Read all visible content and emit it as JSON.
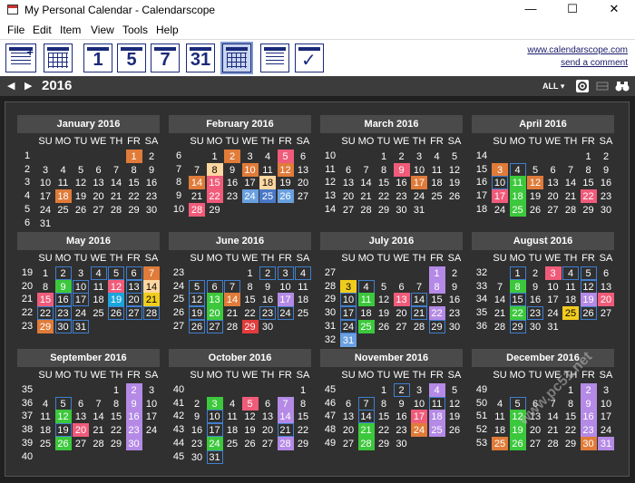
{
  "window": {
    "title": "My Personal Calendar - Calendarscope",
    "minimize": "—",
    "maximize": "☐",
    "close": "✕"
  },
  "menu": [
    "File",
    "Edit",
    "Item",
    "View",
    "Tools",
    "Help"
  ],
  "toolbar": {
    "day_labels": [
      "1",
      "5",
      "7",
      "31"
    ]
  },
  "links": {
    "site": "www.calendarscope.com",
    "feedback": "send a comment"
  },
  "nav": {
    "prev": "◀",
    "next": "▶",
    "year": "2016",
    "filter": "ALL ▾"
  },
  "weekdays": [
    "SU",
    "MO",
    "TU",
    "WE",
    "TH",
    "FR",
    "SA"
  ],
  "colors": {
    "orange": "#e07b39",
    "pink": "#f05b7a",
    "green": "#3cc83c",
    "purple": "#b48ae6",
    "cyan": "#1aa5dc",
    "yellow": "#f0cc1e",
    "peach": "#ffd7a0",
    "blue": "#4a78c8",
    "sky": "#6aa0e0",
    "red": "#e23c3c",
    "outline": "#3f7fcf"
  },
  "months": [
    {
      "name": "January 2016",
      "first": 5,
      "days": 31,
      "weeks": [
        1,
        2,
        3,
        4,
        5,
        6
      ],
      "marks": {
        "1": "or",
        "18": "or"
      }
    },
    {
      "name": "February 2016",
      "first": 1,
      "days": 29,
      "weeks": [
        6,
        7,
        8,
        9,
        10
      ],
      "marks": {
        "2": "or",
        "5": "pk",
        "8": "pe",
        "10": "or",
        "12": "or",
        "14": "or",
        "15": "pk",
        "18": "pe",
        "22": "pk",
        "24": "sl",
        "25": "bl",
        "26": "sl",
        "28": "pk"
      }
    },
    {
      "name": "March 2016",
      "first": 2,
      "days": 31,
      "weeks": [
        10,
        11,
        12,
        13,
        14
      ],
      "marks": {
        "9": "pk",
        "17": "or"
      }
    },
    {
      "name": "April 2016",
      "first": 5,
      "days": 30,
      "weeks": [
        14,
        15,
        16,
        17,
        18
      ],
      "marks": {
        "3": "or",
        "4": "o",
        "10": "o",
        "11": "gr",
        "12": "or",
        "17": "pk",
        "18": "gr",
        "22": "pk",
        "25": "gr"
      }
    },
    {
      "name": "May 2016",
      "first": 0,
      "days": 31,
      "weeks": [
        19,
        20,
        21,
        22,
        23
      ],
      "marks": {
        "2": "o",
        "4": "o",
        "5": "o",
        "6": "o",
        "7": "or",
        "9": "gr",
        "10": "o",
        "12": "pk",
        "13": "o",
        "14": "pe",
        "15": "pk",
        "16": "o",
        "17": "o",
        "19": "cy",
        "20": "o",
        "21": "ye",
        "22": "o",
        "23": "o",
        "26": "o",
        "27": "o",
        "28": "o",
        "29": "or",
        "30": "o",
        "31": "o"
      }
    },
    {
      "name": "June 2016",
      "first": 3,
      "days": 30,
      "weeks": [
        23,
        24,
        25,
        26,
        27
      ],
      "marks": {
        "2": "o",
        "3": "o",
        "4": "o",
        "5": "o",
        "6": "o",
        "7": "o",
        "12": "o",
        "13": "gr",
        "14": "or",
        "17": "pu",
        "19": "o",
        "20": "gr",
        "23": "o",
        "24": "o",
        "26": "o",
        "27": "o",
        "29": "dr"
      }
    },
    {
      "name": "July 2016",
      "first": 5,
      "days": 31,
      "weeks": [
        27,
        28,
        29,
        30,
        31,
        32
      ],
      "marks": {
        "1": "pu",
        "3": "ye",
        "4": "o",
        "8": "pu",
        "10": "o",
        "11": "gr",
        "13": "pk",
        "14": "o",
        "17": "o",
        "21": "o",
        "22": "pu",
        "24": "o",
        "25": "gr",
        "29": "o",
        "31": "sl"
      }
    },
    {
      "name": "August 2016",
      "first": 1,
      "days": 31,
      "weeks": [
        32,
        33,
        34,
        35,
        36
      ],
      "marks": {
        "1": "o",
        "3": "pk",
        "4": "o",
        "5": "o",
        "8": "gr",
        "12": "o",
        "15": "o",
        "19": "pu",
        "20": "pk",
        "22": "gr",
        "23": "o",
        "25": "ye",
        "26": "o",
        "29": "o"
      }
    },
    {
      "name": "September 2016",
      "first": 4,
      "days": 30,
      "weeks": [
        35,
        36,
        37,
        38,
        39,
        40
      ],
      "marks": {
        "2": "pu",
        "5": "o",
        "9": "pu",
        "12": "gr",
        "16": "pu",
        "19": "o",
        "20": "pk",
        "23": "pu",
        "26": "gr",
        "30": "pu"
      }
    },
    {
      "name": "October 2016",
      "first": 6,
      "days": 31,
      "weeks": [
        40,
        41,
        42,
        43,
        44,
        45
      ],
      "marks": {
        "3": "gr",
        "5": "pk",
        "7": "pu",
        "10": "o",
        "14": "pu",
        "17": "o",
        "21": "o",
        "24": "gr",
        "28": "pu",
        "31": "o"
      }
    },
    {
      "name": "November 2016",
      "first": 2,
      "days": 30,
      "weeks": [
        45,
        46,
        47,
        48,
        49
      ],
      "marks": {
        "2": "o",
        "4": "pu",
        "7": "o",
        "11": "o",
        "14": "o",
        "17": "pk",
        "18": "pu",
        "21": "gr",
        "24": "or",
        "25": "pu",
        "28": "gr"
      }
    },
    {
      "name": "December 2016",
      "first": 4,
      "days": 31,
      "weeks": [
        49,
        50,
        51,
        52,
        53
      ],
      "marks": {
        "2": "pu",
        "5": "o",
        "9": "pu",
        "12": "gr",
        "16": "pu",
        "19": "gr",
        "23": "pu",
        "25": "or",
        "26": "gr",
        "30": "or",
        "31": "pu"
      }
    }
  ],
  "watermark": "www.pc51.net"
}
